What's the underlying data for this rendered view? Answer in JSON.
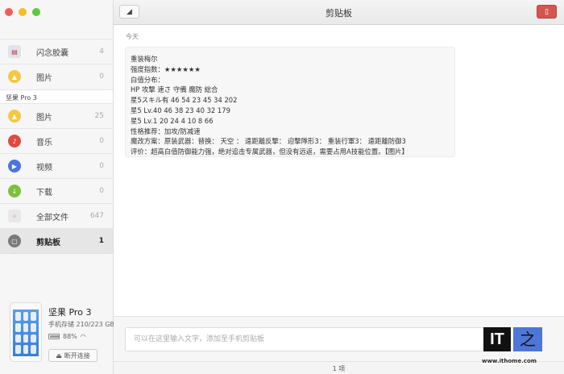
{
  "window": {
    "traffic_colors": [
      "#ee5e57",
      "#f4bc2f",
      "#5fc83f"
    ]
  },
  "sidebar": {
    "items_top": [
      {
        "label": "闪念胶囊",
        "count": "4",
        "icon": "capsule-icon",
        "color": "#dfe3ea"
      },
      {
        "label": "图片",
        "count": "0",
        "icon": "image-icon",
        "color": "#f3c842"
      }
    ],
    "section": "坚果 Pro 3",
    "items": [
      {
        "label": "图片",
        "count": "25",
        "icon": "image-icon",
        "color": "#f3c842"
      },
      {
        "label": "音乐",
        "count": "0",
        "icon": "music-icon",
        "color": "#df4a3f"
      },
      {
        "label": "视频",
        "count": "0",
        "icon": "video-icon",
        "color": "#4a74e0"
      },
      {
        "label": "下载",
        "count": "0",
        "icon": "download-icon",
        "color": "#7cc03e"
      },
      {
        "label": "全部文件",
        "count": "647",
        "icon": "all-files-icon",
        "color": "#e8e8e8"
      },
      {
        "label": "剪贴板",
        "count": "1",
        "icon": "clipboard-icon",
        "color": "#7a7a7a",
        "selected": true
      }
    ],
    "device": {
      "name": "坚果 Pro 3",
      "storage": "手机存储 210/223 GB",
      "battery": "88%",
      "battery_level": 0.88,
      "disconnect": "断开连接"
    }
  },
  "main": {
    "title": "剪贴板",
    "section_label": "今天",
    "clip_lines": [
      "重装梅尔",
      "强度指数：★★★★★★",
      "白值分布：",
      "HP 攻撃 速さ 守備 魔防 総合",
      "星5スキル有 46 54 23 45 34 202",
      "星5 Lv.40 46 38 23 40 32 179",
      "星5 Lv.1 20 24 4 10 8 66",
      "性格推荐：加攻/防减速",
      "魔改方案：原装武器：替换： 天空 ： 遠距離反撃： 迎撃隊形3： 重装行軍3： 遠距離防御3",
      "评价：超高白值防御能力强，绝对追击专属武器，但没有远返，需要占用A技能位置。【图片】"
    ],
    "input_placeholder": "可以在这里输入文字，添加至手机剪贴板",
    "footer": "1 项"
  },
  "watermark": {
    "logo_text": "IT之家",
    "url": "www.ithome.com"
  }
}
